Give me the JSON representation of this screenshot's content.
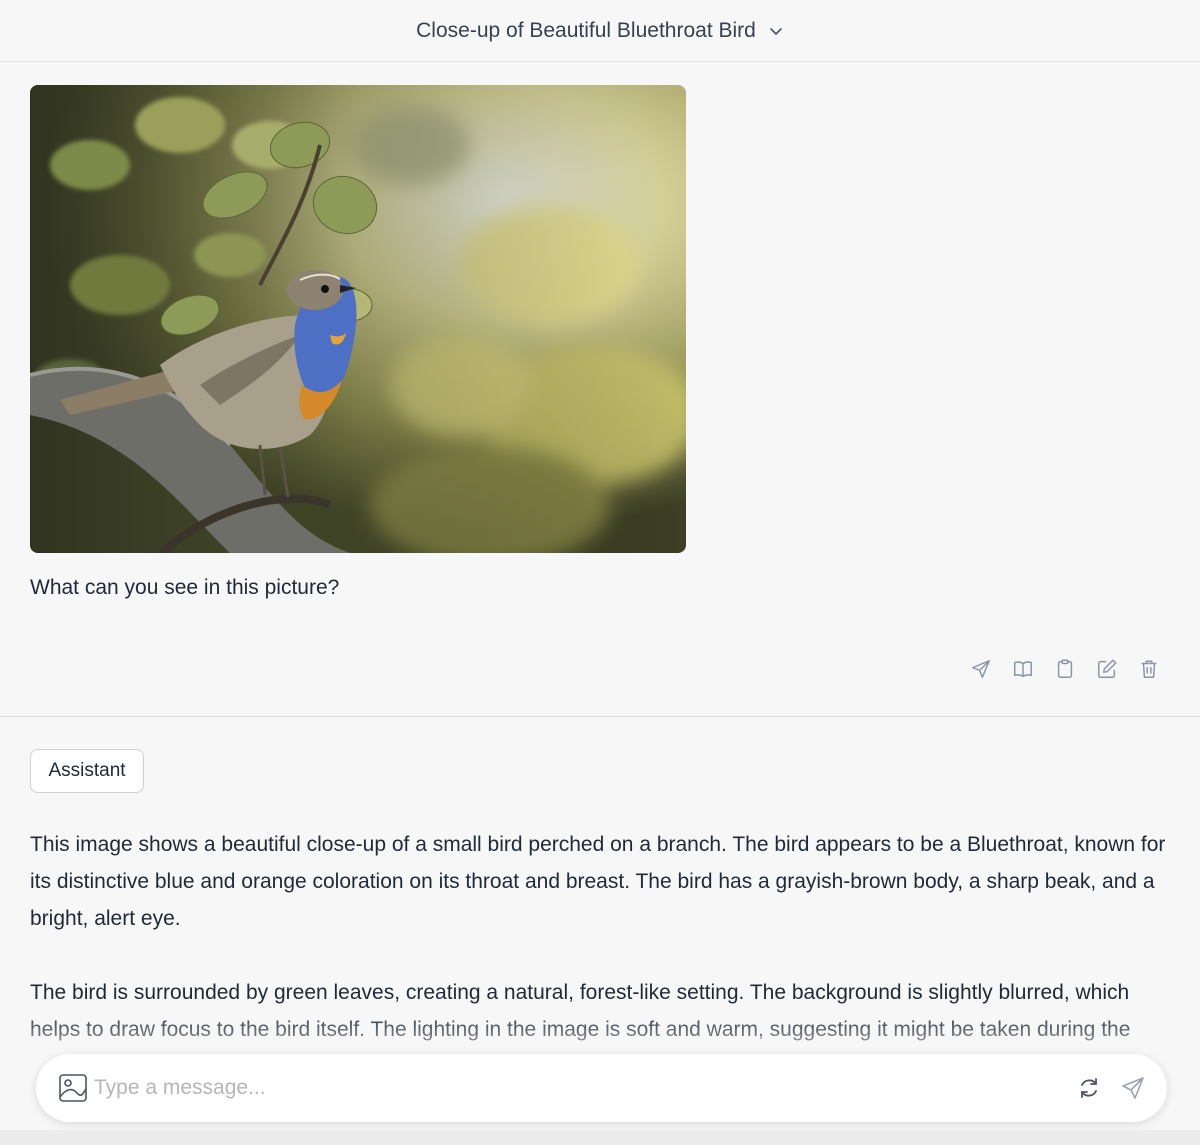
{
  "header": {
    "title": "Close-up of Beautiful Bluethroat Bird"
  },
  "user_message": {
    "text": "What can you see in this picture?",
    "actions": [
      "send-icon",
      "book-icon",
      "clipboard-icon",
      "edit-icon",
      "trash-icon"
    ]
  },
  "assistant": {
    "role_label": "Assistant",
    "paragraphs": [
      "This image shows a beautiful close-up of a small bird perched on a branch. The bird appears to be a Bluethroat, known for its distinctive blue and orange coloration on its throat and breast. The bird has a grayish-brown body, a sharp beak, and a bright, alert eye.",
      "The bird is surrounded by green leaves, creating a natural, forest-like setting. The background is slightly blurred, which helps to draw focus to the bird itself. The lighting in the image is soft and warm, suggesting it might be taken during the"
    ]
  },
  "composer": {
    "placeholder": "Type a message..."
  },
  "colors": {
    "background": "#f7f7f7",
    "icon": "#8a94a6",
    "border": "#e2e2e2"
  }
}
